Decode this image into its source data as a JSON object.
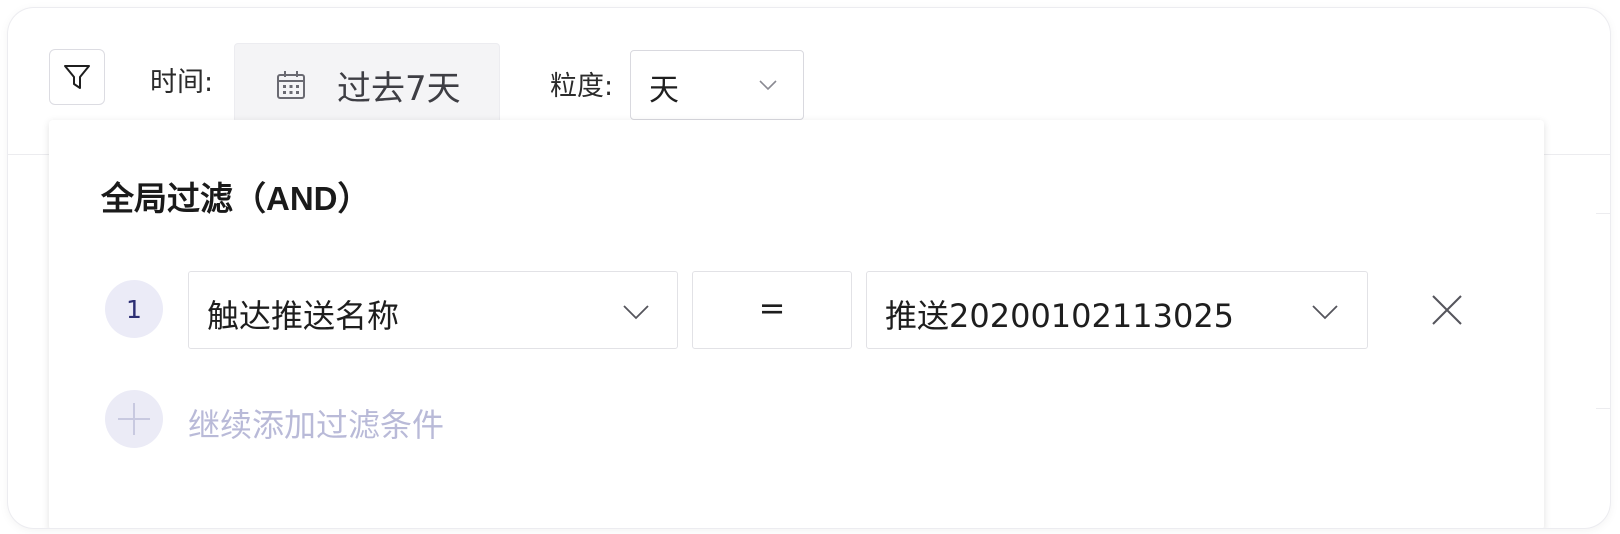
{
  "toolbar": {
    "filter_icon": "filter-funnel-icon",
    "time_label": "时间:",
    "date_range": "过去7天",
    "calendar_icon": "calendar-icon",
    "granularity_label": "粒度:",
    "granularity_value": "天"
  },
  "filter_panel": {
    "title": "全局过滤（AND）",
    "conditions": [
      {
        "index": "1",
        "property": "触达推送名称",
        "operator": "=",
        "value": "推送20200102113025"
      }
    ],
    "add_condition_label": "继续添加过滤条件"
  },
  "colors": {
    "accent": "#2c2e73",
    "accent_light": "#ebebf7",
    "muted_text": "#b9bad8",
    "border": "#e2e2e6"
  }
}
